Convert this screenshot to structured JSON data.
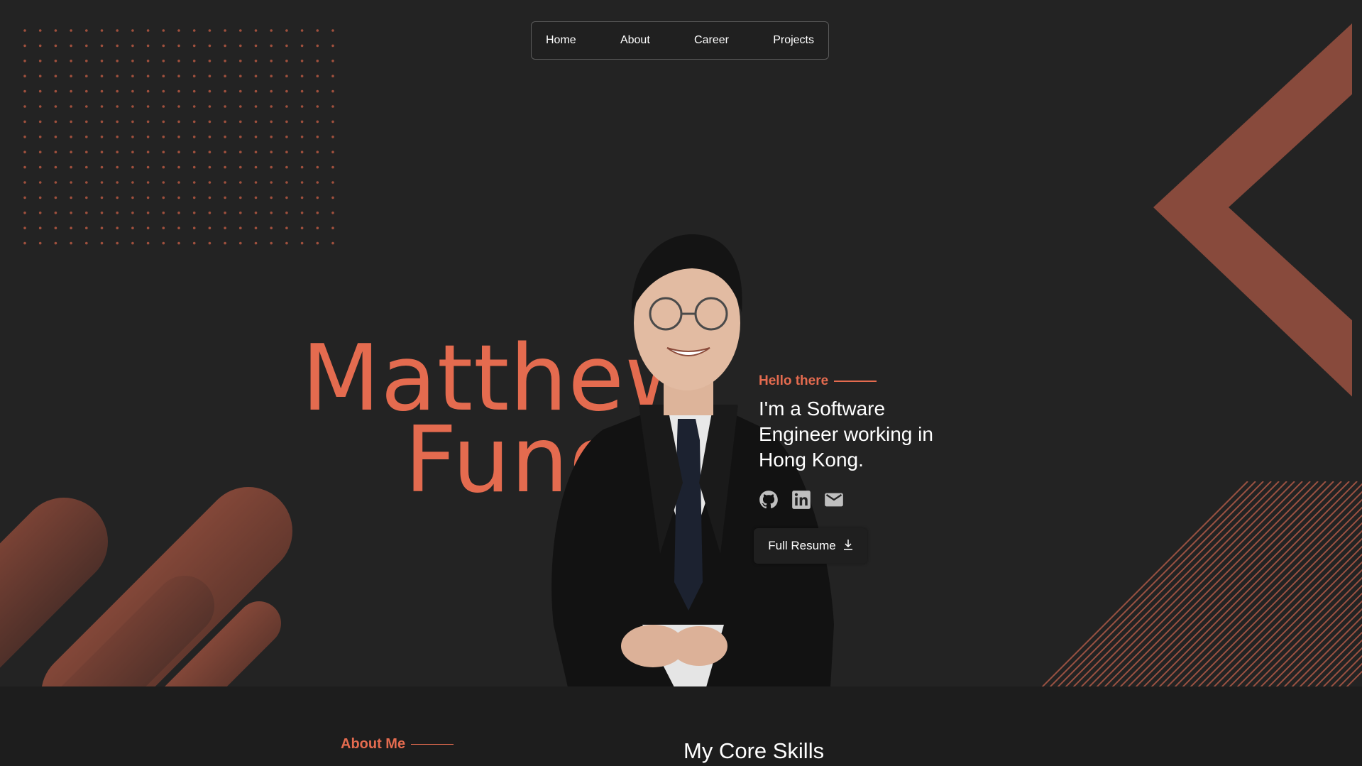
{
  "nav": {
    "home": "Home",
    "about": "About",
    "career": "Career",
    "projects": "Projects"
  },
  "hero": {
    "first_name": "Matthew",
    "last_name": "Fung",
    "hello": "Hello there",
    "tagline": "I'm a Software Engineer working in Hong Kong.",
    "resume_label": "Full Resume"
  },
  "social_icons": [
    "github-icon",
    "linkedin-icon",
    "email-icon"
  ],
  "sections": {
    "about_heading": "About Me",
    "skills_heading": "My Core Skills"
  },
  "colors": {
    "accent": "#e46b4f",
    "accent_dark": "#8a4c3d",
    "background": "#232323",
    "footer": "#1d1d1d"
  }
}
